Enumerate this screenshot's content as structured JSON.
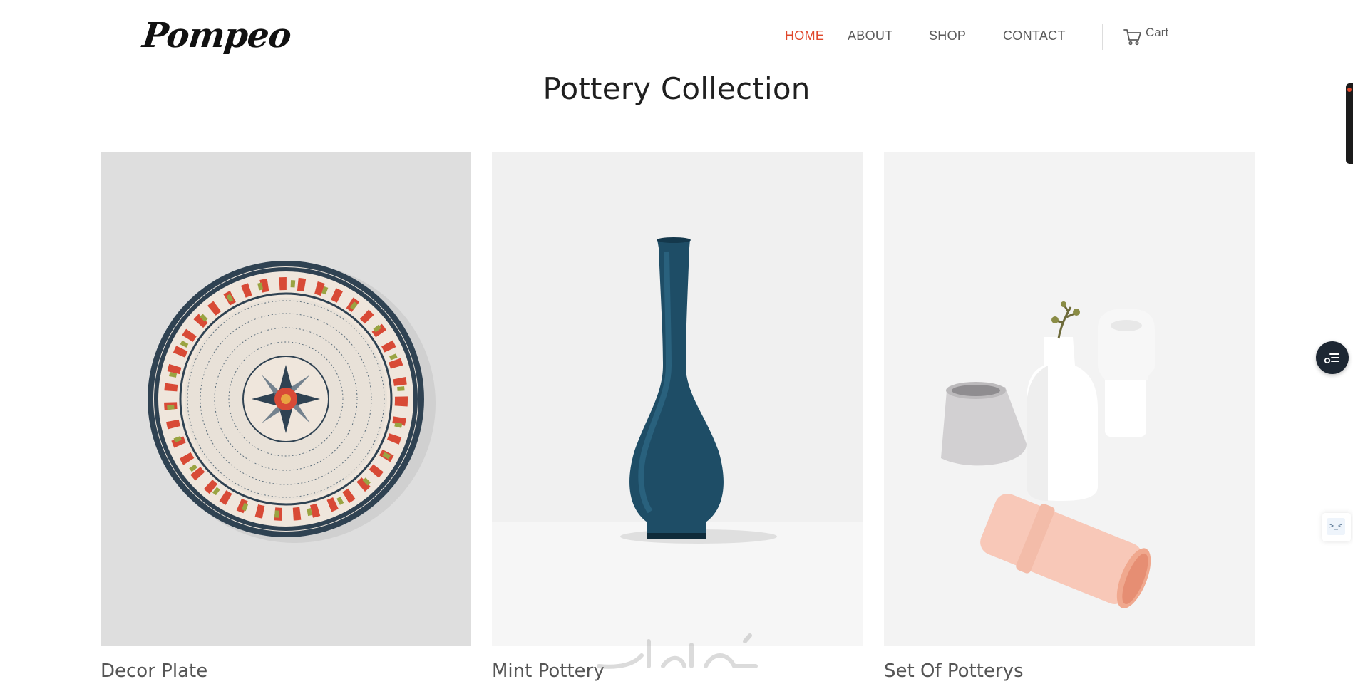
{
  "brand": {
    "logo_text": "Pompeo"
  },
  "nav": {
    "items": [
      {
        "label": "HOME",
        "active": true
      },
      {
        "label": "ABOUT",
        "active": false
      },
      {
        "label": "SHOP",
        "active": false
      },
      {
        "label": "CONTACT",
        "active": false
      }
    ],
    "cart_label": "Cart",
    "cart_icon": "cart-icon",
    "active_color": "#e0472b"
  },
  "main": {
    "title": "Pottery Collection",
    "products": [
      {
        "name": "Decor Plate"
      },
      {
        "name": "Mint Pottery"
      },
      {
        "name": "Set Of Potterys"
      }
    ]
  },
  "widgets": {
    "float_icon": "list-menu-icon",
    "mini_icon": "console-icon",
    "mini_text": ">_<"
  }
}
